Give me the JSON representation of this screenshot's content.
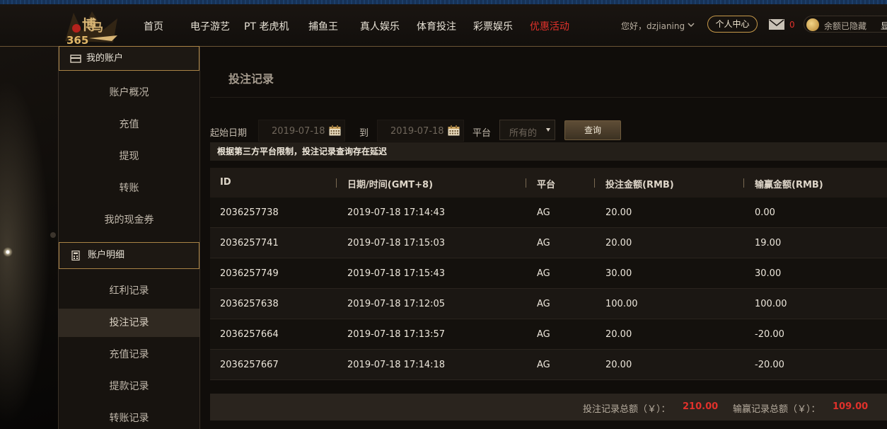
{
  "nav": {
    "items": [
      "首页",
      "电子游艺",
      "PT 老虎机",
      "捕鱼王",
      "真人娱乐",
      "体育投注",
      "彩票娱乐",
      "优惠活动"
    ],
    "greeting": "您好，dzjianing",
    "personal_center": "个人中心",
    "mail_count": "0",
    "balance_hidden": "余额已隐藏",
    "balance_show": "显"
  },
  "sidebar": {
    "account_head": "我的账户",
    "account_items": [
      "账户概况",
      "充值",
      "提现",
      "转账",
      "我的现金券"
    ],
    "detail_head": "账户明细",
    "detail_items": [
      "红利记录",
      "投注记录",
      "充值记录",
      "提款记录",
      "转账记录"
    ],
    "active_item": "投注记录"
  },
  "main": {
    "title": "投注记录",
    "filter": {
      "start_label": "起始日期",
      "start_value": "2019-07-18",
      "to_label": "到",
      "end_value": "2019-07-18",
      "platform_label": "平台",
      "platform_value": "所有的",
      "query_button": "查询"
    },
    "notice": "根据第三方平台限制，投注记录查询存在延迟",
    "table": {
      "headers": [
        "ID",
        "日期/时间(GMT+8)",
        "平台",
        "投注金额(RMB)",
        "输赢金额(RMB)"
      ],
      "rows": [
        [
          "2036257738",
          "2019-07-18 17:14:43",
          "AG",
          "20.00",
          "0.00"
        ],
        [
          "2036257741",
          "2019-07-18 17:15:03",
          "AG",
          "20.00",
          "19.00"
        ],
        [
          "2036257749",
          "2019-07-18 17:15:43",
          "AG",
          "30.00",
          "30.00"
        ],
        [
          "2036257638",
          "2019-07-18 17:12:05",
          "AG",
          "100.00",
          "100.00"
        ],
        [
          "2036257664",
          "2019-07-18 17:13:57",
          "AG",
          "20.00",
          "-20.00"
        ],
        [
          "2036257667",
          "2019-07-18 17:14:18",
          "AG",
          "20.00",
          "-20.00"
        ]
      ]
    },
    "summary": {
      "bet_total_label": "投注记录总额（￥）：",
      "bet_total_value": "210.00",
      "win_total_label": "输赢记录总额（￥）：",
      "win_total_value": "109.00"
    }
  },
  "colors": {
    "accent_gold": "#c79a4a",
    "highlight_red": "#e0312b"
  }
}
